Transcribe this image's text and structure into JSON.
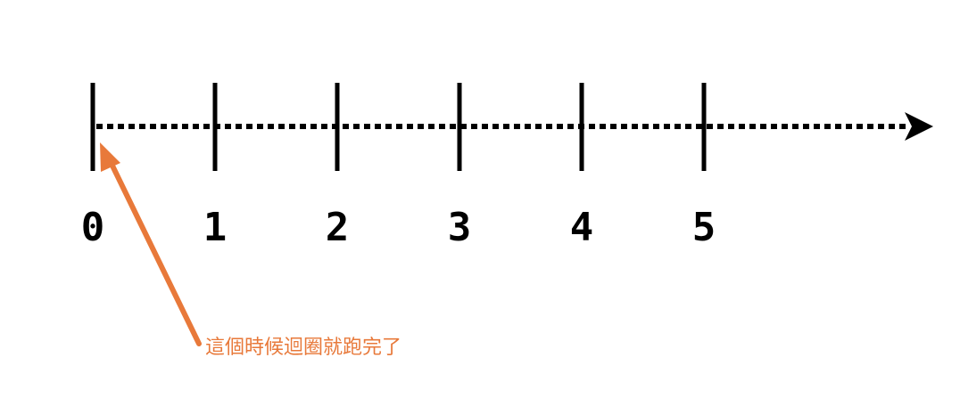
{
  "number_line": {
    "tick_labels": [
      "0",
      "1",
      "2",
      "3",
      "4",
      "5"
    ],
    "line_style": "dotted",
    "direction": "right",
    "color": "#000000"
  },
  "annotation": {
    "text": "這個時候迴圈就跑完了",
    "points_to_tick": "0",
    "color": "#e8793a"
  }
}
